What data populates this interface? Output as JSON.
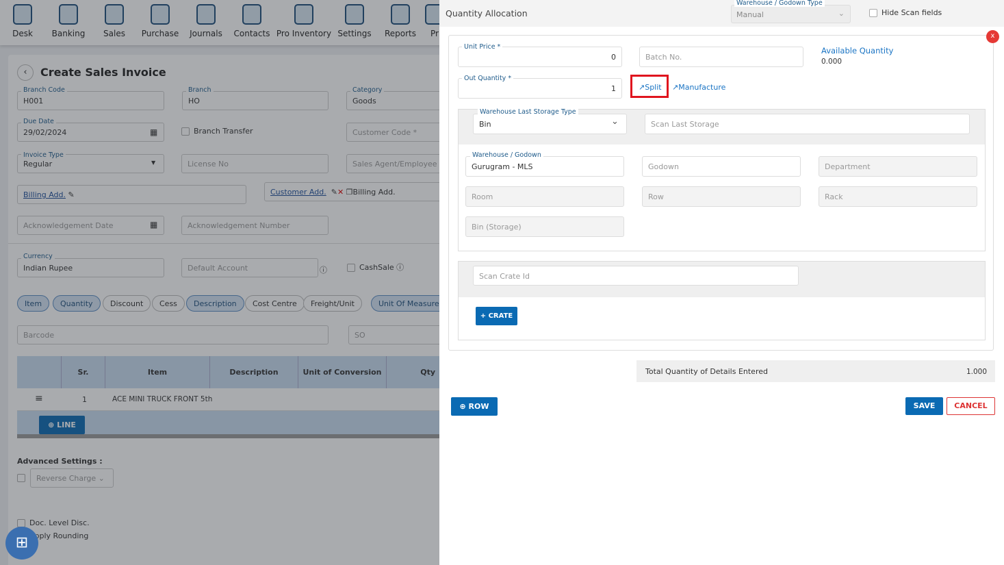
{
  "nav": {
    "items": [
      "Desk",
      "Banking",
      "Sales",
      "Purchase",
      "Journals",
      "Contacts",
      "Pro Inventory",
      "Settings",
      "Reports",
      "Pr"
    ]
  },
  "invoice": {
    "title": "Create Sales Invoice",
    "branch_code": {
      "label": "Branch Code",
      "value": "H001"
    },
    "branch": {
      "label": "Branch",
      "value": "HO"
    },
    "category": {
      "label": "Category",
      "value": "Goods"
    },
    "due_date": {
      "label": "Due Date",
      "value": "29/02/2024"
    },
    "branch_transfer": "Branch Transfer",
    "customer_code_placeholder": "Customer Code *",
    "invoice_type": {
      "label": "Invoice Type",
      "value": "Regular"
    },
    "license_placeholder": "License No",
    "sales_agent_placeholder": "Sales Agent/Employee",
    "billing_add": "Billing Add.",
    "customer_add": "Customer Add.",
    "billing_add_copy": "Billing Add.",
    "ack_date_placeholder": "Acknowledgement Date",
    "ack_number_placeholder": "Acknowledgement Number",
    "currency": {
      "label": "Currency",
      "value": "Indian Rupee"
    },
    "default_account_placeholder": "Default Account",
    "cashsale": "CashSale",
    "pills": [
      {
        "label": "Item",
        "on": true
      },
      {
        "label": "Quantity",
        "on": true
      },
      {
        "label": "Discount",
        "on": false
      },
      {
        "label": "Cess",
        "on": false
      },
      {
        "label": "Description",
        "on": true
      },
      {
        "label": "Cost Centre",
        "on": false
      },
      {
        "label": "Freight/Unit",
        "on": false
      },
      {
        "label": "Unit Of Measurem",
        "on": true
      }
    ],
    "barcode_placeholder": "Barcode",
    "so_placeholder": "SO",
    "table": {
      "headers": [
        "",
        "Sr.",
        "Item",
        "Description",
        "Unit of Conversion",
        "Qty"
      ],
      "rows": [
        {
          "sr": "1",
          "item": "ACE MINI TRUCK FRONT 5th"
        }
      ]
    },
    "line_button": "LINE",
    "advanced_settings": "Advanced Settings :",
    "reverse_charge": "Reverse Charge",
    "doc_level_disc": "Doc. Level Disc.",
    "apply_rounding": "Apply Rounding"
  },
  "panel": {
    "title": "Quantity Allocation",
    "warehouse_type": {
      "label": "Warehouse / Godown Type",
      "value": "Manual"
    },
    "hide_scan": "Hide Scan fields",
    "unit_price": {
      "label": "Unit Price *",
      "value": "0"
    },
    "batch_placeholder": "Batch No.",
    "available_quantity": {
      "label": "Available Quantity",
      "value": "0.000"
    },
    "out_quantity": {
      "label": "Out Quantity *",
      "value": "1"
    },
    "split": "Split",
    "manufacture": "Manufacture",
    "last_storage_type": {
      "label": "Warehouse Last Storage Type",
      "value": "Bin"
    },
    "scan_last_storage_placeholder": "Scan Last Storage",
    "warehouse": {
      "label": "Warehouse / Godown",
      "value": "Gurugram - MLS"
    },
    "godown_placeholder": "Godown",
    "department_placeholder": "Department",
    "room_placeholder": "Room",
    "row_placeholder": "Row",
    "rack_placeholder": "Rack",
    "bin_placeholder": "Bin (Storage)",
    "scan_crate_placeholder": "Scan Crate Id",
    "crate_button": "+ CRATE",
    "total_label": "Total Quantity of Details Entered",
    "total_value": "1.000",
    "row_button": "ROW",
    "save": "SAVE",
    "cancel": "CANCEL",
    "close": "x",
    "highlight_color": "#e0141e",
    "accent_color": "#0a6ab3"
  }
}
